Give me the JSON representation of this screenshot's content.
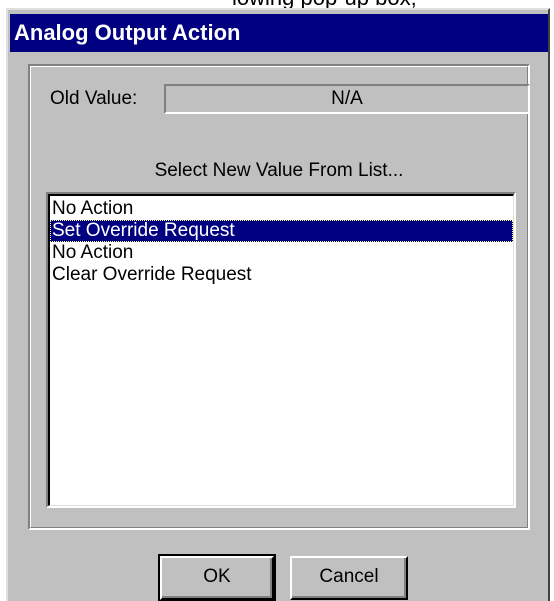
{
  "background_caption": "lowing pop-up box;",
  "dialog": {
    "title": "Analog Output Action",
    "old_value_label": "Old Value:",
    "old_value": "N/A",
    "prompt": "Select New Value From List...",
    "list_items": [
      "No Action",
      "Set Override Request",
      "No Action",
      "Clear Override Request"
    ],
    "selected_index": 1,
    "ok_label": "OK",
    "cancel_label": "Cancel"
  },
  "colors": {
    "title_bar": "#000080",
    "dialog_face": "#c0c0c0",
    "selection": "#000080"
  }
}
